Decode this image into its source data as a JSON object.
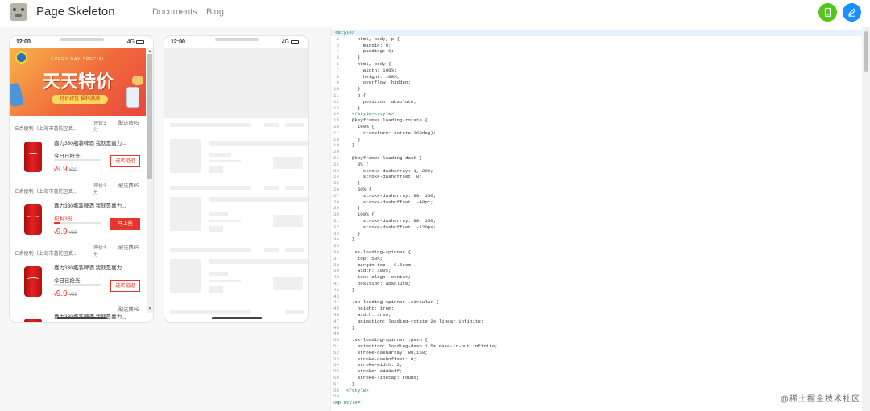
{
  "header": {
    "brand": "Page Skeleton",
    "nav": [
      "Documents",
      "Blog"
    ],
    "buttons": [
      {
        "icon": "mobile-icon",
        "color": "#52c41a"
      },
      {
        "icon": "edit-icon",
        "color": "#1890ff"
      }
    ]
  },
  "phone_status": {
    "time": "12:00",
    "signal": "4G"
  },
  "banner": {
    "small_text": "EVERY DAY SPECIAL",
    "title": "天天特价",
    "pill": "特价好货  福利满满"
  },
  "shops": [
    {
      "name": "E点便利（上海市普陀区真...",
      "rating": "评价3分",
      "fee": "配送费¥5"
    },
    {
      "name": "E点便利（上海市普陀区真...",
      "rating": "评价3分",
      "fee": "配送费¥5"
    },
    {
      "name": "E点便利（上海市普陀区真...",
      "rating": "评价3分",
      "fee": "配送费¥5"
    },
    {
      "name": "",
      "rating": "",
      "fee": "配送费¥5"
    }
  ],
  "items": [
    {
      "title": "嘉力330瓶装啤酒 我就是嘉力...",
      "status": "今日已抢光",
      "status_red": false,
      "progress": 0,
      "price_symbol": "¥",
      "price": "9.9",
      "orig_price": "¥20",
      "button": "进店逛逛",
      "button_solid": false
    },
    {
      "title": "嘉力330瓶装啤酒 我就是嘉力...",
      "status": "仅剩3份",
      "status_red": true,
      "progress": 0.12,
      "price_symbol": "¥",
      "price": "9.9",
      "orig_price": "¥20",
      "button": "马上抢",
      "button_solid": true
    },
    {
      "title": "嘉力330瓶装啤酒 我就是嘉力...",
      "status": "今日已抢光",
      "status_red": false,
      "progress": 0,
      "price_symbol": "¥",
      "price": "9.9",
      "orig_price": "¥20",
      "button": "进店逛逛",
      "button_solid": false
    },
    {
      "title": "嘉力330瓶装啤酒 我就是嘉力...",
      "status": "",
      "status_red": false,
      "progress": 0,
      "price_symbol": "",
      "price": "",
      "orig_price": "",
      "button": "",
      "button_solid": false
    }
  ],
  "code_lines": [
    "<style>",
    "        html, body, p {",
    "          margin: 0;",
    "          padding: 0;",
    "        }",
    "        html, body {",
    "          width: 100%;",
    "          height: 100%;",
    "          overflow: hidden;",
    "        }",
    "        p {",
    "          position: absolute;",
    "        }",
    "      </style><style>",
    "      @keyframes loading-rotate {",
    "        100% {",
    "          transform: rotate(360deg);",
    "        }",
    "      }",
    "",
    "      @keyframes loading-dash {",
    "        0% {",
    "          stroke-dasharray: 1, 200;",
    "          stroke-dashoffset: 0;",
    "        }",
    "        50% {",
    "          stroke-dasharray: 90, 150;",
    "          stroke-dashoffset: -40px;",
    "        }",
    "        100% {",
    "          stroke-dasharray: 90, 150;",
    "          stroke-dashoffset: -120px;",
    "        }",
    "      }",
    "",
    "      .sk-loading-spinner {",
    "        top: 50%;",
    "        margin-top: -0.5rem;",
    "        width: 100%;",
    "        text-align: center;",
    "        position: absolute;",
    "      }",
    "",
    "      .sk-loading-spinner .circular {",
    "        height: 1rem;",
    "        width: 1rem;",
    "        animation: loading-rotate 2s linear infinite;",
    "      }",
    "",
    "      .sk-loading-spinner .path {",
    "        animation: loading-dash 1.5s ease-in-out infinite;",
    "        stroke-dasharray: 90,150;",
    "        stroke-dashoffset: 0;",
    "        stroke-width: 2;",
    "        stroke: #409eff;",
    "        stroke-linecap: round;",
    "      }",
    "    </style>",
    "",
    "<p style=\""
  ],
  "watermark": "@稀土掘金技术社区"
}
